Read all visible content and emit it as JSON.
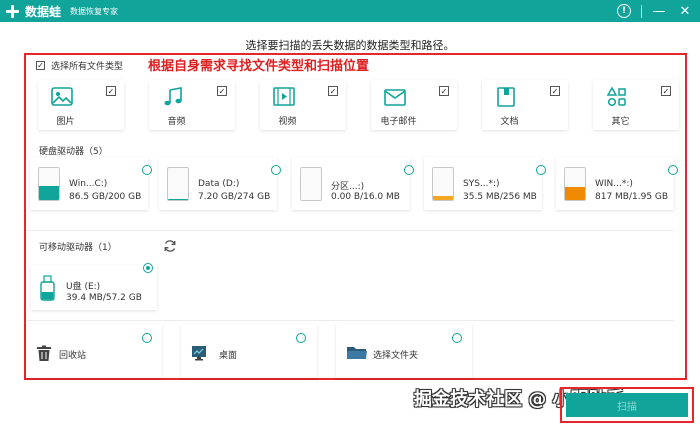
{
  "app": {
    "name": "数据蛙",
    "subtitle": "数据恢复专家",
    "controls": [
      "help-icon",
      "minimize-icon",
      "close-icon"
    ]
  },
  "heading": "选择要扫描的丢失数据的数据类型和路径。",
  "annotation": "根据自身需求寻找文件类型和扫描位置",
  "select_all": {
    "label": "选择所有文件类型",
    "checked": true
  },
  "file_types": [
    {
      "label": "图片",
      "icon": "image-icon",
      "checked": true
    },
    {
      "label": "音频",
      "icon": "music-icon",
      "checked": true
    },
    {
      "label": "视频",
      "icon": "video-icon",
      "checked": true
    },
    {
      "label": "电子邮件",
      "icon": "email-icon",
      "checked": true
    },
    {
      "label": "文档",
      "icon": "document-icon",
      "checked": true
    },
    {
      "label": "其它",
      "icon": "other-icon",
      "checked": true
    }
  ],
  "hard_drives": {
    "title": "硬盘驱动器（5）",
    "items": [
      {
        "name": "Win...C:)",
        "size": "86.5 GB/200 GB",
        "usage": 0.43,
        "color": "#10a49a",
        "selected": false
      },
      {
        "name": "Data (D:)",
        "size": "7.20 GB/274 GB",
        "usage": 0.03,
        "color": "#10a49a",
        "selected": false
      },
      {
        "name": "分区...:)",
        "size": "0.00  B/16.0 MB",
        "usage": 0.0,
        "color": "#f5a623",
        "selected": false
      },
      {
        "name": "SYS...*:)",
        "size": "35.5 MB/256 MB",
        "usage": 0.14,
        "color": "#f5a623",
        "selected": false
      },
      {
        "name": "WIN...*:)",
        "size": "817 MB/1.95 GB",
        "usage": 0.42,
        "color": "#f08a00",
        "selected": false
      }
    ]
  },
  "removable_drives": {
    "title": "可移动驱动器（1）",
    "items": [
      {
        "name": "U盘 (E:)",
        "size": "39.4 MB/57.2 GB",
        "selected": true
      }
    ]
  },
  "locations": [
    {
      "label": "回收站",
      "icon": "recycle-bin-icon"
    },
    {
      "label": "桌面",
      "icon": "desktop-icon"
    },
    {
      "label": "选择文件夹",
      "icon": "folder-icon"
    }
  ],
  "watermark": "掘金技术社区 @ 小明助手",
  "next_button": {
    "label": "扫描"
  },
  "colors": {
    "accent": "#10a49a",
    "highlight": "#e5262b"
  }
}
